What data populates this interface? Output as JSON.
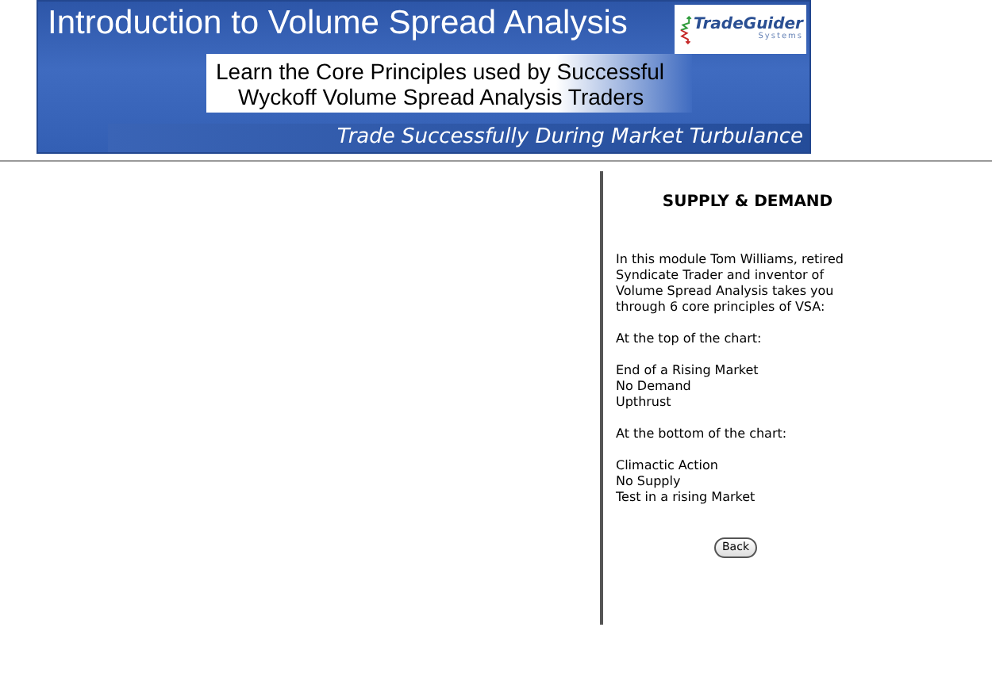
{
  "banner": {
    "title": "Introduction to Volume Spread Analysis",
    "subtitle_lines": [
      "Learn the Core Principles used by Successful",
      "Wyckoff Volume Spread Analysis Traders"
    ],
    "tagline": "Trade Successfully During Market Turbulance",
    "logo": {
      "name": "TradeGuider",
      "sub": "Systems"
    }
  },
  "panel": {
    "heading": "SUPPLY & DEMAND",
    "blocks": [
      {
        "kind": "paragraph",
        "text": "In this module Tom Williams, retired Syndicate Trader and inventor of Volume Spread Analysis takes you through 6 core principles of VSA:"
      },
      {
        "kind": "paragraph",
        "text": "At the top of the chart:"
      },
      {
        "kind": "list",
        "items": [
          "End of a Rising Market",
          "No Demand",
          "Upthrust"
        ]
      },
      {
        "kind": "paragraph",
        "text": "At the bottom of the chart:"
      },
      {
        "kind": "list",
        "items": [
          "Climactic Action",
          "No Supply",
          "Test in a rising Market"
        ]
      }
    ],
    "back_button": "Back"
  }
}
